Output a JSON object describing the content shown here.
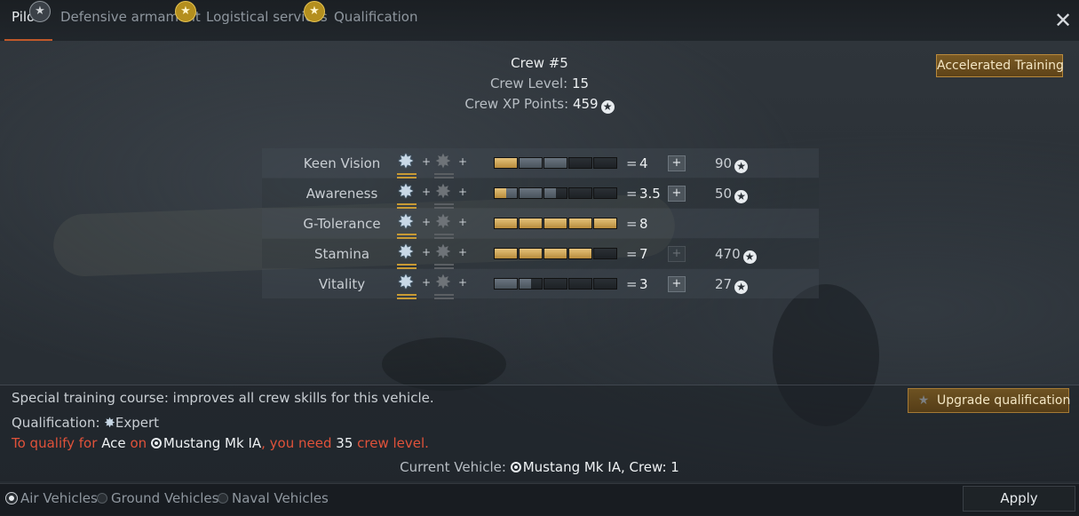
{
  "tabs": [
    {
      "label": "Pilot",
      "active": true,
      "icon": "star-icon",
      "icon_color": "gray"
    },
    {
      "label": "Defensive armament",
      "active": false,
      "icon": "",
      "icon_color": ""
    },
    {
      "label": "Logistical services",
      "active": false,
      "icon": "star-icon",
      "icon_color": "gold"
    },
    {
      "label": "Qualification",
      "active": false,
      "icon": "",
      "icon_color": ""
    }
  ],
  "header": {
    "crew_name": "Crew #5",
    "crew_level_label": "Crew Level:",
    "crew_level": "15",
    "crew_xp_label": "Crew XP Points:",
    "crew_xp": "459",
    "accelerated_training": "Accelerated Training"
  },
  "skills": [
    {
      "name": "Keen Vision",
      "value": "4",
      "cost": "90",
      "fill_segments": 1.0,
      "bonus_segments": 2.0,
      "plus_enabled": true
    },
    {
      "name": "Awareness",
      "value": "3.5",
      "cost": "50",
      "fill_segments": 0.5,
      "bonus_segments": 2.0,
      "plus_enabled": true
    },
    {
      "name": "G-Tolerance",
      "value": "8",
      "cost": "",
      "fill_segments": 5.0,
      "bonus_segments": 0,
      "plus_enabled": null
    },
    {
      "name": "Stamina",
      "value": "7",
      "cost": "470",
      "fill_segments": 4.0,
      "bonus_segments": 0,
      "plus_enabled": false
    },
    {
      "name": "Vitality",
      "value": "3",
      "cost": "27",
      "fill_segments": 0,
      "bonus_segments": 1.5,
      "plus_enabled": true
    }
  ],
  "skill_symbols": {
    "plus": "+",
    "equals": "="
  },
  "bottom": {
    "description": "Special training course: improves all crew skills for this vehicle.",
    "qualification_label": "Qualification:",
    "qualification_value": "Expert",
    "req_prefix": "To qualify for",
    "req_rank": "Ace",
    "req_on": "on",
    "req_vehicle": "Mustang Mk IA",
    "req_need": ", you need",
    "req_level": "35",
    "req_suffix": "crew level.",
    "current_vehicle_label": "Current Vehicle:",
    "current_vehicle": "Mustang Mk IA",
    "crew_suffix": ", Crew: 1",
    "upgrade_button": "Upgrade qualification"
  },
  "footer": {
    "radios": [
      {
        "label": "Air Vehicles",
        "selected": true
      },
      {
        "label": "Ground Vehicles",
        "selected": false
      },
      {
        "label": "Naval Vehicles",
        "selected": false
      }
    ],
    "apply": "Apply"
  },
  "colors": {
    "accent_tab_underline": "#c0582a",
    "gold_button": "#7a5a24",
    "requirement_red": "#e0523a",
    "skill_bar_fill": "#e5c27a"
  }
}
